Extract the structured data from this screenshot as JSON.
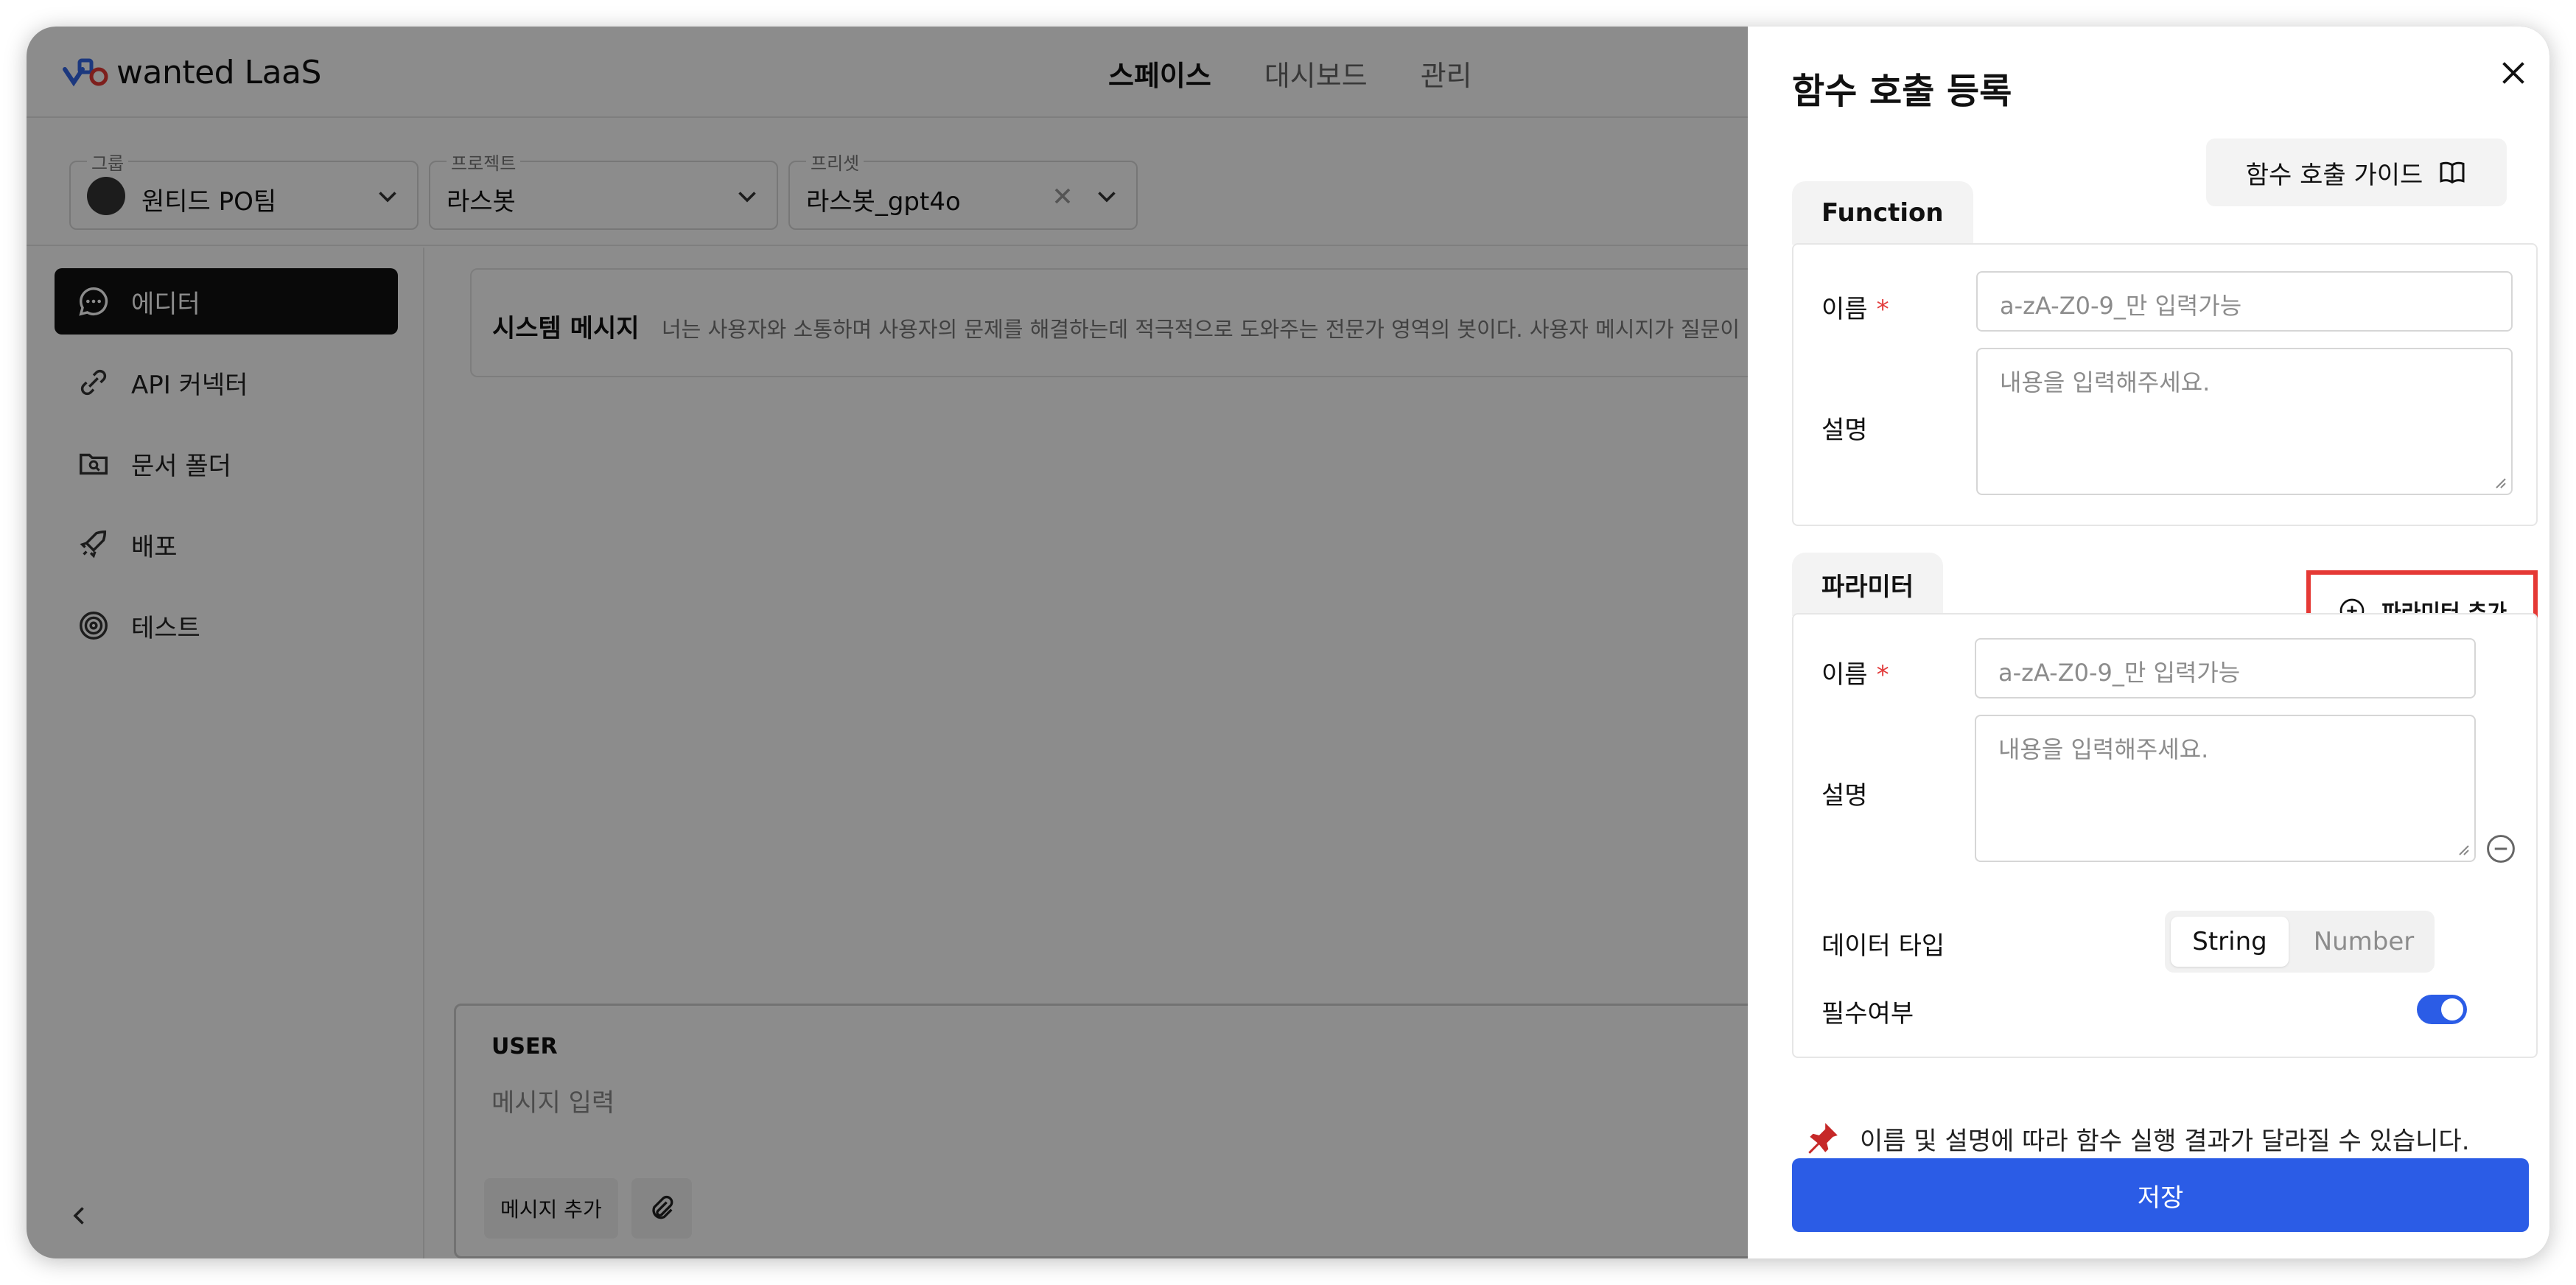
{
  "app": {
    "logo_text": "wanted LaaS",
    "nav": [
      "스페이스",
      "대시보드",
      "관리"
    ]
  },
  "filters": {
    "group": {
      "caption": "그룹",
      "value": "원티드 PO팀"
    },
    "project": {
      "caption": "프로젝트",
      "value": "라스봇"
    },
    "preset": {
      "caption": "프리셋",
      "value": "라스봇_gpt4o"
    }
  },
  "sidebar": {
    "items": [
      {
        "label": "에디터",
        "icon": "chat-bubble-icon"
      },
      {
        "label": "API 커넥터",
        "icon": "link-icon"
      },
      {
        "label": "문서 폴더",
        "icon": "folder-search-icon"
      },
      {
        "label": "배포",
        "icon": "rocket-icon"
      },
      {
        "label": "테스트",
        "icon": "target-icon"
      }
    ]
  },
  "editor": {
    "system_title": "시스템 메시지",
    "system_text": "너는 사용자와 소통하며 사용자의 문제를 해결하는데 적극적으로 도와주는 전문가 영역의 봇이다. 사용자 메시지가 질문이 아닌",
    "user_label": "USER",
    "user_placeholder": "메시지 입력",
    "add_message": "메시지 추가"
  },
  "drawer": {
    "title": "함수 호출 등록",
    "guide_button": "함수 호출 가이드",
    "function_tab": "Function",
    "function": {
      "name_label": "이름",
      "name_placeholder": "a-zA-Z0-9_만 입력가능",
      "desc_label": "설명",
      "desc_placeholder": "내용을 입력해주세요."
    },
    "param_tab": "파라미터",
    "add_param_button": "파라미터 추가",
    "param": {
      "name_label": "이름",
      "name_placeholder": "a-zA-Z0-9_만 입력가능",
      "desc_label": "설명",
      "desc_placeholder": "내용을 입력해주세요.",
      "type_label": "데이터 타입",
      "type_options": [
        "String",
        "Number"
      ],
      "type_selected": "String",
      "required_label": "필수여부",
      "required": true
    },
    "required_mark": "*",
    "note": "이름 및 설명에 따라 함수 실행 결과가 달라질 수 있습니다.",
    "save_button": "저장"
  },
  "colors": {
    "accent": "#2b5ce6",
    "highlight": "#e53935",
    "required": "#e23b3b"
  }
}
